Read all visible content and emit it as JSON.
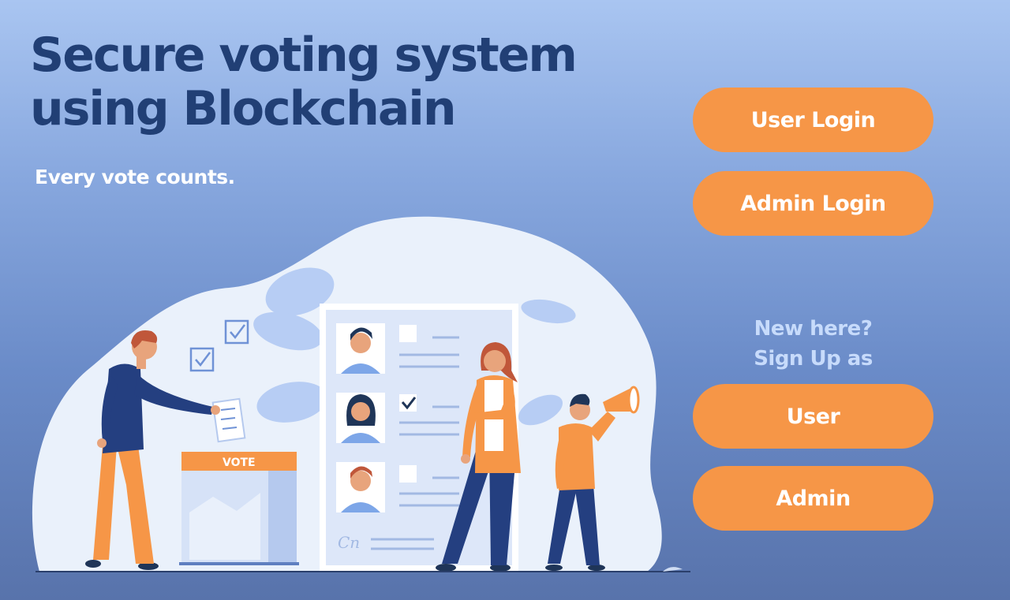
{
  "hero": {
    "title_line1": "Secure voting system",
    "title_line2": "using Blockchain",
    "tagline": "Every vote counts."
  },
  "login": {
    "user_label": "User Login",
    "admin_label": "Admin Login"
  },
  "signup": {
    "prompt_line1": "New here?",
    "prompt_line2": "Sign Up as",
    "user_label": "User",
    "admin_label": "Admin"
  },
  "illustration": {
    "ballot_box_label": "VOTE",
    "signature": "Cn"
  },
  "colors": {
    "accent": "#f69647",
    "title": "#213f75",
    "background_top": "#a9c5f1",
    "background_bottom": "#5873ab"
  }
}
